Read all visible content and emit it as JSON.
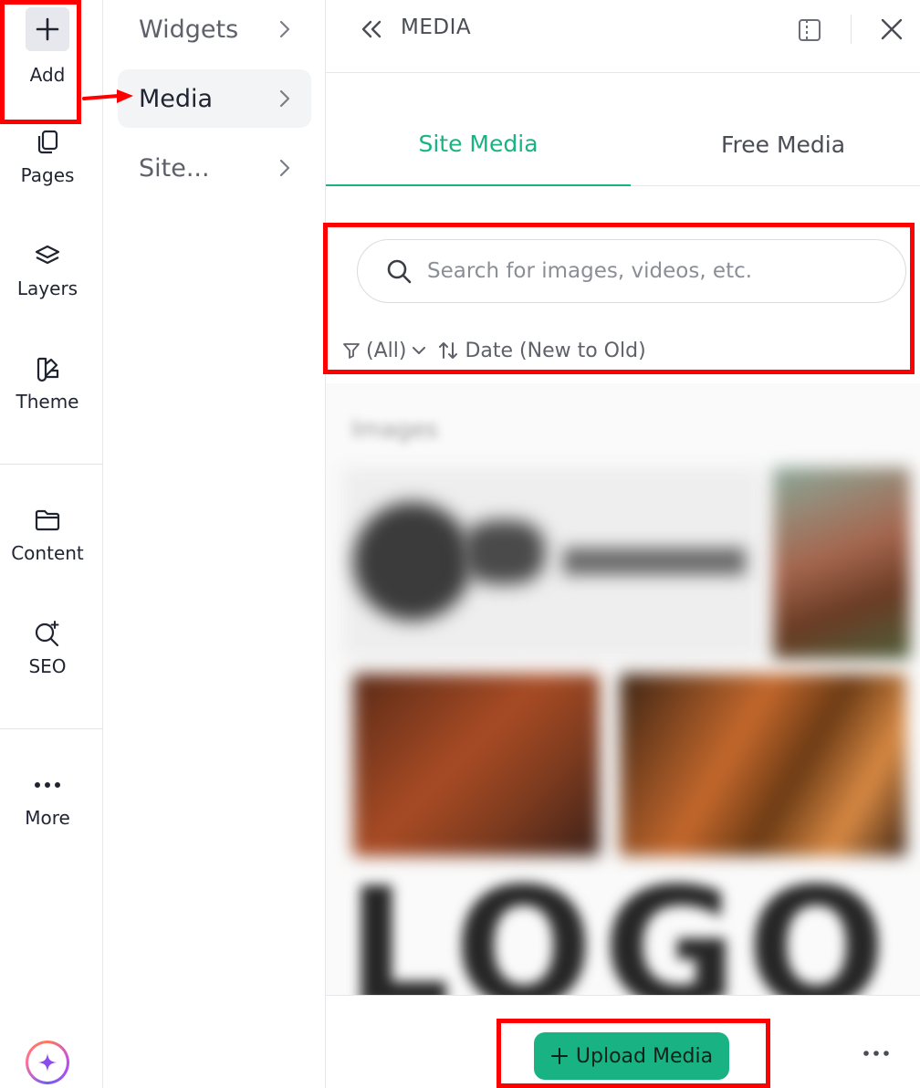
{
  "rail": {
    "items": [
      {
        "label": "Add",
        "icon": "plus-icon"
      },
      {
        "label": "Pages",
        "icon": "pages-icon"
      },
      {
        "label": "Layers",
        "icon": "layers-icon"
      },
      {
        "label": "Theme",
        "icon": "theme-icon"
      },
      {
        "label": "Content",
        "icon": "folder-icon"
      },
      {
        "label": "SEO",
        "icon": "seo-icon"
      },
      {
        "label": "More",
        "icon": "more-icon"
      }
    ],
    "ai_icon": "sparkle-icon"
  },
  "submenu": {
    "items": [
      {
        "label": "Widgets"
      },
      {
        "label": "Media"
      },
      {
        "label": "Site..."
      }
    ],
    "active": "Media"
  },
  "panel": {
    "title": "MEDIA",
    "tabs": [
      {
        "label": "Site Media",
        "active": true
      },
      {
        "label": "Free Media",
        "active": false
      }
    ],
    "search": {
      "placeholder": "Search for images, videos, etc.",
      "value": ""
    },
    "filter": {
      "label": "(All)"
    },
    "sort": {
      "label": "Date (New to Old)"
    },
    "section_label": "Images",
    "logo_text": "LOGO",
    "upload_label": "Upload Media"
  },
  "colors": {
    "accent": "#19b383",
    "annotation": "#ff0000",
    "rail_selected_bg": "#e6e8ed"
  }
}
